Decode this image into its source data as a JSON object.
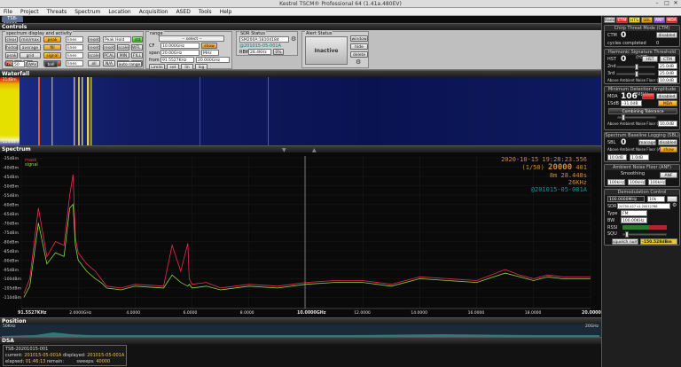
{
  "window": {
    "title": "Kestrel TSCM® Professional 64 (1.41a.480EV)"
  },
  "menu": [
    "File",
    "Project",
    "Threats",
    "Spectrum",
    "Location",
    "Acquisition",
    "ASED",
    "Tools",
    "Help"
  ],
  "session_tab": "TSB-20201...",
  "sections": {
    "controls": "Controls",
    "waterfall": "Waterfall",
    "spectrum": "Spectrum",
    "position": "Position",
    "dsa": "DSA"
  },
  "controls": {
    "display_group": "spectrum display and activity",
    "rows": [
      [
        "clear",
        "min/max",
        "peak",
        "lines",
        "reset"
      ],
      [
        "history",
        "average",
        "fill",
        "lines",
        "reset"
      ],
      [
        "peak",
        "grid",
        "signal",
        "lines",
        "scale"
      ],
      [
        "trace",
        "cursor",
        "clear",
        "lines",
        "all"
      ]
    ],
    "peak_mode": "Peak Hold",
    "std_label": "std",
    "rec": "rec",
    "tag": "tag",
    "ln_label": "lin",
    "ln_value": "50",
    "wav": "WAV",
    "ball": "ball",
    "mid_buttons": [
      [
        "reset",
        "scale"
      ],
      [
        "WFL BG",
        "PCAL"
      ],
      [
        "MIN",
        "FILL"
      ],
      [
        "N/A",
        "sig"
      ],
      [
        "grid",
        "auto range"
      ]
    ],
    "range_group": "range",
    "select_placeholder": "-- select --",
    "cf_label": "CF",
    "cf_value": "10.000GHz",
    "show": "show",
    "stop": "stop",
    "span_label": "span",
    "span_value": "20.00GHz",
    "span_unit": "MHz",
    "from_label": "from",
    "from_value": "91.5527KHz",
    "to_value": "20.000GHz",
    "range_buttons": [
      "Limits",
      "set",
      "lin",
      "log"
    ]
  },
  "sdr": {
    "title": "SDR Status",
    "device": "SM200A:18104184",
    "session": "@201015-05-001A",
    "rbw_label": "RBW",
    "rbw_value": "28.4KHz",
    "rbw_unit": "0%"
  },
  "alert": {
    "title": "Alert Status",
    "state": "Inactive",
    "buttons": [
      "window",
      "hide",
      "delete"
    ]
  },
  "waterfall": {
    "top_label": "-31dBm",
    "bottom_label": "-114dBm"
  },
  "spectrum": {
    "legend": [
      "mask",
      "signal"
    ],
    "info": {
      "timestamp": "2020-10-15 19:28:23.556",
      "sweep_frac": "(1/50)",
      "count": "20000",
      "num": "401",
      "time": "8m 28.448s",
      "rbw": "26KHz",
      "session": "@201015-05-001A"
    }
  },
  "chart_data": {
    "type": "line",
    "xlabel": "",
    "ylabel": "",
    "xlim": [
      0,
      20
    ],
    "ylim": [
      -116,
      -34
    ],
    "x_tick_labels": [
      "91.5527KHz",
      "2.0000GHz",
      "4.0000",
      "6.0000",
      "8.0000",
      "10.0000GHz",
      "12.0000",
      "14.0000",
      "16.0000",
      "18.0000",
      "20.0000GHz"
    ],
    "y_tick_labels": [
      "-35dBm",
      "-40dBm",
      "-45dBm",
      "-50dBm",
      "-55dBm",
      "-60dBm",
      "-65dBm",
      "-70dBm",
      "-75dBm",
      "-80dBm",
      "-85dBm",
      "-90dBm",
      "-95dBm",
      "-100dBm",
      "-105dBm",
      "-110dBm"
    ],
    "series": [
      {
        "name": "mask",
        "color": "#ff2a5a",
        "x": [
          0.09,
          0.3,
          0.6,
          0.9,
          1.2,
          1.5,
          1.7,
          1.82,
          1.9,
          2.0,
          2.3,
          2.6,
          2.8,
          3.0,
          3.5,
          4.0,
          5.0,
          5.3,
          5.6,
          5.85,
          5.9,
          6.0,
          6.5,
          7.0,
          8.0,
          9.0,
          10.0,
          11.0,
          12.0,
          13.0,
          14.0,
          15.0,
          16.0,
          17.0,
          17.5,
          18.0,
          18.5,
          19.0,
          20.0
        ],
        "y": [
          -108,
          -100,
          -62,
          -88,
          -80,
          -82,
          -55,
          -44,
          -78,
          -86,
          -92,
          -96,
          -100,
          -104,
          -105,
          -103,
          -104,
          -82,
          -96,
          -81,
          -100,
          -103,
          -102,
          -105,
          -103,
          -104,
          -102,
          -101,
          -101,
          -103,
          -99,
          -100,
          -101,
          -95,
          -98,
          -100,
          -98,
          -99,
          -99
        ]
      },
      {
        "name": "signal",
        "color": "#8fe24a",
        "x": [
          0.09,
          0.3,
          0.6,
          0.9,
          1.2,
          1.5,
          1.7,
          1.82,
          1.9,
          2.0,
          2.3,
          2.6,
          2.8,
          3.0,
          3.5,
          4.0,
          5.0,
          5.3,
          5.6,
          5.85,
          5.9,
          6.0,
          6.5,
          7.0,
          8.0,
          9.0,
          10.0,
          11.0,
          12.0,
          13.0,
          14.0,
          15.0,
          16.0,
          17.0,
          17.5,
          18.0,
          18.5,
          19.0,
          20.0
        ],
        "y": [
          -110,
          -104,
          -70,
          -92,
          -86,
          -88,
          -62,
          -60,
          -82,
          -90,
          -96,
          -100,
          -102,
          -105,
          -106,
          -104,
          -105,
          -98,
          -102,
          -104,
          -103,
          -105,
          -104,
          -106,
          -104,
          -105,
          -103,
          -102,
          -102,
          -104,
          -100,
          -101,
          -102,
          -97,
          -99,
          -101,
          -99,
          -100,
          -100
        ]
      }
    ]
  },
  "position": {
    "left_label": "50KHz",
    "right_label": "20GHz"
  },
  "dsa": {
    "title": "TSB-20201015-001",
    "current_label": "current:",
    "current_value": "201015-05-001A",
    "displayed_label": "displayed:",
    "displayed_value": "201015-05-001A",
    "elapsed_label": "elapsed:",
    "elapsed_value": "01:46:13",
    "remain_label": "remain:",
    "sweeps_label": "sweeps:",
    "sweeps_value": "40000"
  },
  "right": {
    "tabs": [
      "Radio",
      "CTM",
      "HTS",
      "SBL",
      "ANF",
      "MDA"
    ],
    "ctm": {
      "title": "Chirp Threat Mode (CTM)",
      "label": "CTM",
      "value": "0",
      "state": "disabled",
      "cycles": "cycles completed",
      "cycles_value": "0"
    },
    "hts": {
      "title": "Harmonic Signature Threshold (HST)",
      "label": "HST",
      "value": "0",
      "mode": "HST",
      "btn": "CTM",
      "second": "2nd",
      "third": "3rd",
      "v1": "25.0dB",
      "v2": "25.0dB",
      "above": "Above Ambient Noise Floor (AIF)",
      "above_value": "10.0dB"
    },
    "mda": {
      "title": "Minimum Detection Amplitude (MDA)",
      "label": "MDA",
      "value": "106",
      "state": "disabled",
      "sub": "1SdB",
      "sub2": "-31.0dB",
      "btn": "MDA",
      "tolerance": "Combining Tolerance",
      "above": "Above Ambient Noise Floor (AIF)",
      "above_value": "10.0dB"
    },
    "sbl": {
      "title": "Spectrum Baseline Logging (SBL)",
      "label": "SBL",
      "value": "0",
      "btn": "manage",
      "state": "disabled",
      "above": "Above Ambient Noise Floor (AIF)",
      "above_btn": "show",
      "v1": "10.0dB",
      "v2": "1.0dB"
    },
    "anf": {
      "title": "Ambient Noise Floor (ANF)",
      "label": "Smoothing",
      "btn": "ANF",
      "v1": "100kHz",
      "v2": "100kHz",
      "v3": "100kHz"
    },
    "demod": {
      "title": "Demodulation Control",
      "freq": "100.0000MHz",
      "step": "10k",
      "sdr_label": "SDR",
      "sdr_value": "20750-427 v1 20012768",
      "type_label": "Type",
      "type_value": "FM",
      "bw_label": "BW",
      "bw_value": "100.00KHz",
      "rssi_label": "RSSI",
      "squ_label": "SQU",
      "squelch_btn": "squelch num",
      "level": "-150.528dBm"
    }
  }
}
